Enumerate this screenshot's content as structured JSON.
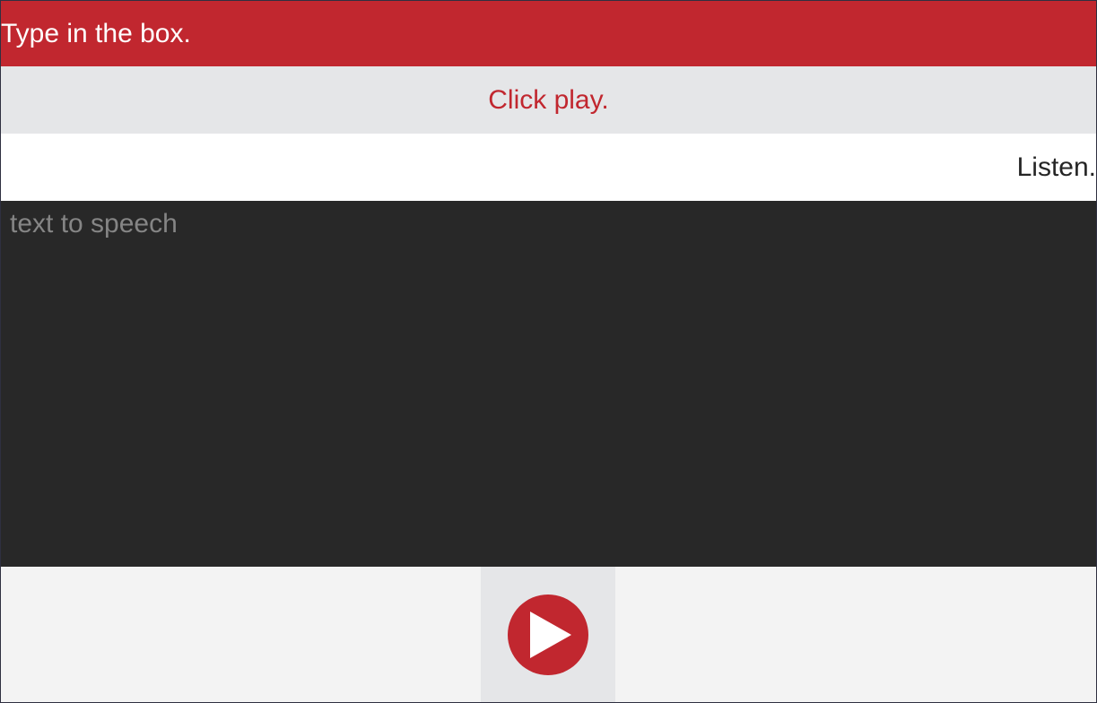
{
  "steps": {
    "type": "Type in the box.",
    "click": "Click play.",
    "listen": "Listen."
  },
  "input": {
    "placeholder": "text to speech",
    "value": ""
  },
  "play_button": {
    "icon": "play-icon",
    "accent_color": "#c1272f"
  },
  "colors": {
    "header": "#c1272f",
    "instruction_band": "#e5e6e8",
    "textarea_background": "#282828",
    "control_band": "#f3f3f3"
  }
}
